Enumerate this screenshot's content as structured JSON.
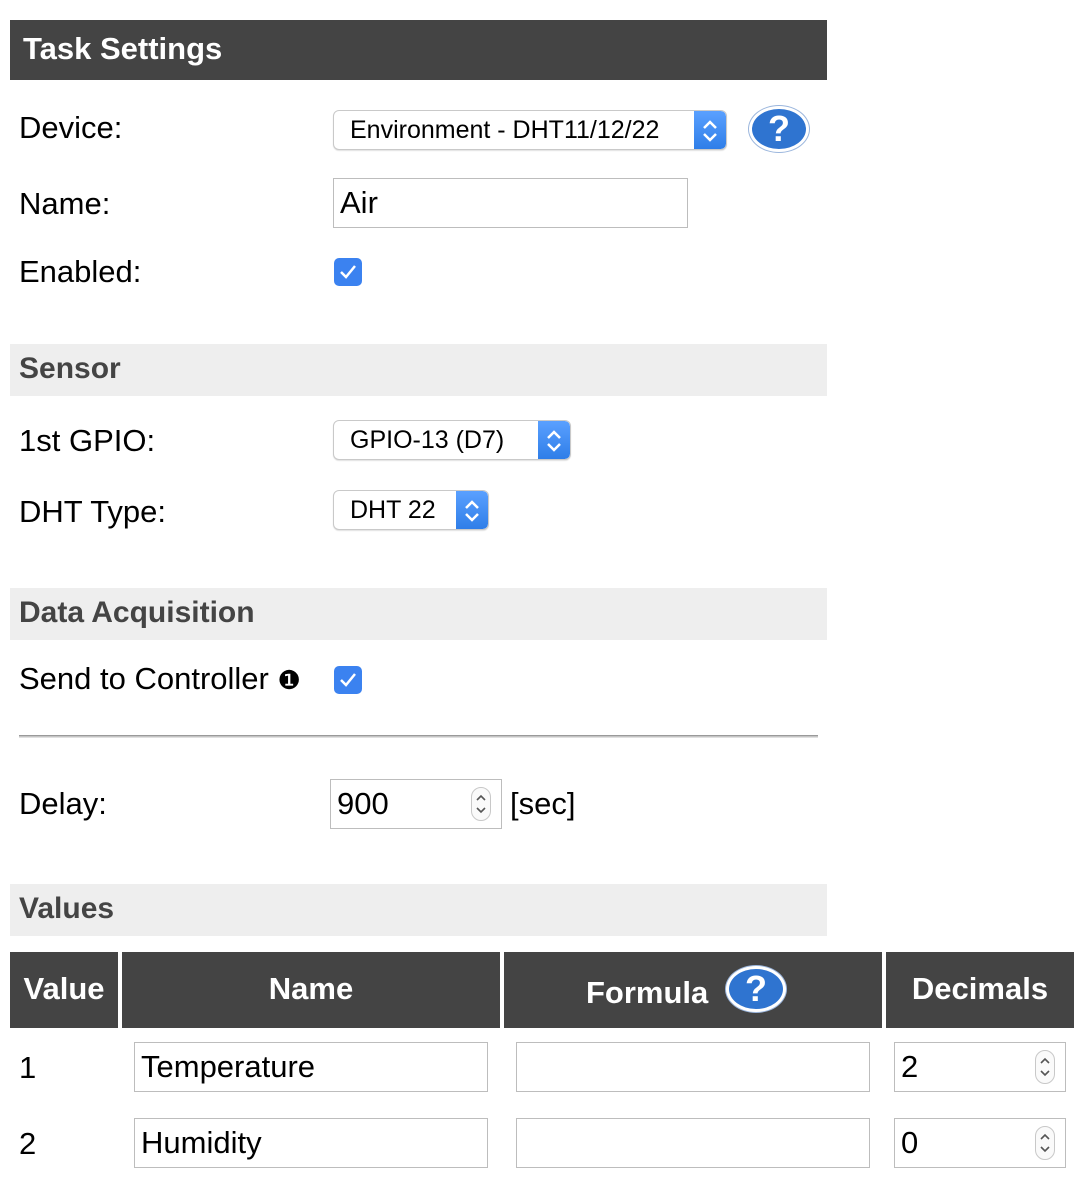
{
  "task_settings": {
    "header": "Task Settings",
    "device_label": "Device:",
    "device_value": "Environment - DHT11/12/22",
    "help_glyph": "?",
    "name_label": "Name:",
    "name_value": "Air",
    "enabled_label": "Enabled:",
    "enabled": true
  },
  "sensor": {
    "header": "Sensor",
    "gpio_label": "1st GPIO:",
    "gpio_value": "GPIO-13 (D7)",
    "dht_type_label": "DHT Type:",
    "dht_type_value": "DHT 22"
  },
  "data_acquisition": {
    "header": "Data Acquisition",
    "send_label": "Send to Controller",
    "send_marker": "❶",
    "send_enabled": true,
    "delay_label": "Delay:",
    "delay_value": "900",
    "delay_unit": "[sec]"
  },
  "values": {
    "header": "Values",
    "columns": [
      "Value",
      "Name",
      "Formula",
      "Decimals"
    ],
    "help_glyph": "?",
    "rows": [
      {
        "index": "1",
        "name": "Temperature",
        "formula": "",
        "decimals": "2"
      },
      {
        "index": "2",
        "name": "Humidity",
        "formula": "",
        "decimals": "0"
      }
    ]
  },
  "colors": {
    "header_dark": "#444444",
    "header_light": "#eeeeee",
    "accent_blue": "#3b82f0",
    "help_blue": "#2f74d0"
  }
}
